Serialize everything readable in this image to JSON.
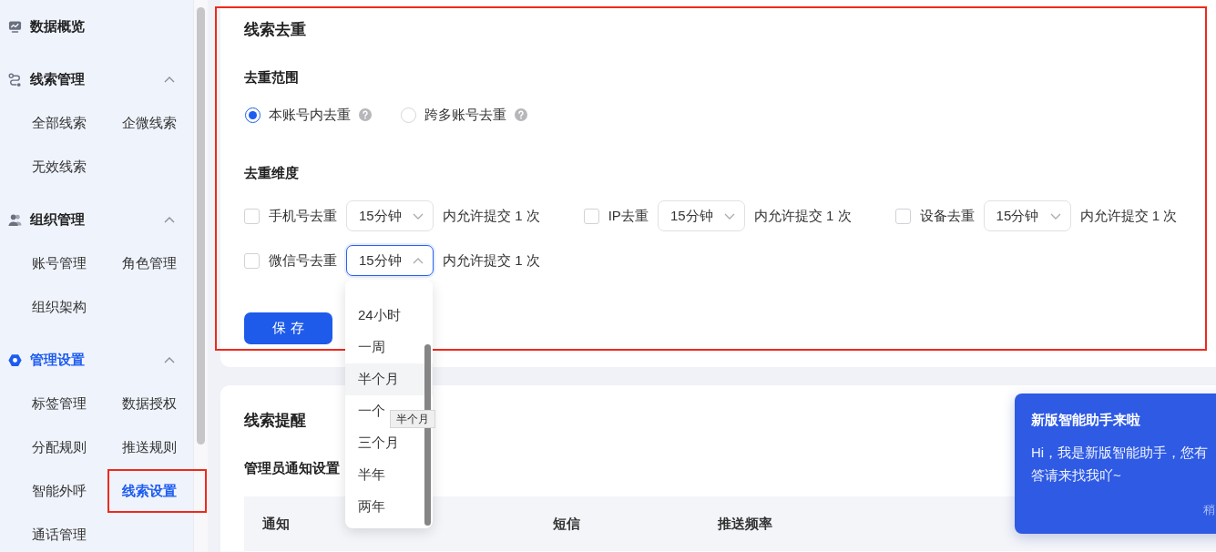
{
  "sidebar": {
    "groups": [
      {
        "kind": "link",
        "label": "数据概览",
        "active": false
      },
      {
        "kind": "group",
        "label": "线索管理",
        "active": false,
        "expanded": true,
        "items": [
          {
            "label": "全部线索",
            "selected": false,
            "framed": false
          },
          {
            "label": "企微线索",
            "selected": false,
            "framed": false
          },
          {
            "label": "无效线索",
            "selected": false,
            "framed": false
          }
        ]
      },
      {
        "kind": "group",
        "label": "组织管理",
        "active": false,
        "expanded": true,
        "items": [
          {
            "label": "账号管理",
            "selected": false,
            "framed": false
          },
          {
            "label": "角色管理",
            "selected": false,
            "framed": false
          },
          {
            "label": "组织架构",
            "selected": false,
            "framed": false
          }
        ]
      },
      {
        "kind": "group",
        "label": "管理设置",
        "active": true,
        "expanded": true,
        "items": [
          {
            "label": "标签管理",
            "selected": false,
            "framed": false
          },
          {
            "label": "数据授权",
            "selected": false,
            "framed": false
          },
          {
            "label": "分配规则",
            "selected": false,
            "framed": false
          },
          {
            "label": "推送规则",
            "selected": false,
            "framed": false
          },
          {
            "label": "智能外呼",
            "selected": false,
            "framed": false
          },
          {
            "label": "线索设置",
            "selected": true,
            "framed": true
          },
          {
            "label": "通话管理",
            "selected": false,
            "framed": false
          }
        ]
      }
    ]
  },
  "dedup": {
    "title": "线索去重",
    "framed": true,
    "scope": {
      "label": "去重范围",
      "options": [
        {
          "label": "本账号内去重",
          "selected": true,
          "help": true
        },
        {
          "label": "跨多账号去重",
          "selected": false,
          "help": true
        }
      ]
    },
    "dimension": {
      "label": "去重维度",
      "rules": [
        {
          "label": "手机号去重",
          "checked": false,
          "window": "15分钟",
          "open": false,
          "suffix": "内允许提交 1 次"
        },
        {
          "label": "IP去重",
          "checked": false,
          "window": "15分钟",
          "open": false,
          "suffix": "内允许提交 1 次"
        },
        {
          "label": "设备去重",
          "checked": false,
          "window": "15分钟",
          "open": false,
          "suffix": "内允许提交 1 次"
        },
        {
          "label": "微信号去重",
          "checked": false,
          "window": "15分钟",
          "open": true,
          "suffix": "内允许提交 1 次"
        }
      ]
    },
    "dropdown": {
      "options": [
        {
          "label": "24小时",
          "hovered": false
        },
        {
          "label": "一周",
          "hovered": false
        },
        {
          "label": "半个月",
          "hovered": true
        },
        {
          "label": "一个",
          "hovered": false
        },
        {
          "label": "三个月",
          "hovered": false
        },
        {
          "label": "半年",
          "hovered": false
        },
        {
          "label": "两年",
          "hovered": false
        }
      ],
      "tooltip": "半个月"
    },
    "save_button": "保 存"
  },
  "reminder": {
    "title": "线索提醒",
    "subtitle": "管理员通知设置",
    "columns": [
      "通知",
      "短信",
      "推送频率"
    ]
  },
  "assistant": {
    "title": "新版智能助手来啦",
    "lines": [
      "Hi，我是新版智能助手，您有",
      "答请来找我吖~"
    ],
    "footer": "稍"
  }
}
